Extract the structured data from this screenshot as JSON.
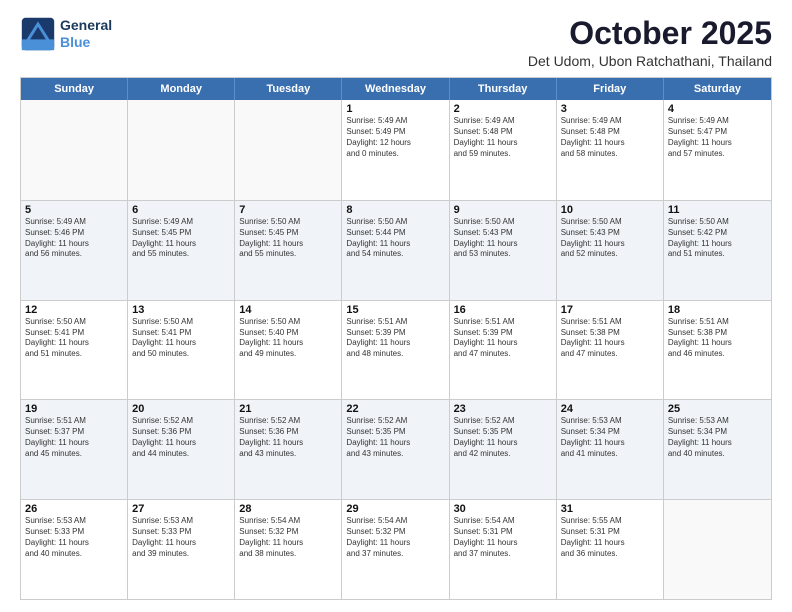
{
  "logo": {
    "line1": "General",
    "line2": "Blue"
  },
  "header": {
    "title": "October 2025",
    "location": "Det Udom, Ubon Ratchathani, Thailand"
  },
  "days_of_week": [
    "Sunday",
    "Monday",
    "Tuesday",
    "Wednesday",
    "Thursday",
    "Friday",
    "Saturday"
  ],
  "weeks": [
    [
      {
        "day": "",
        "empty": true
      },
      {
        "day": "",
        "empty": true
      },
      {
        "day": "",
        "empty": true
      },
      {
        "day": "1",
        "lines": [
          "Sunrise: 5:49 AM",
          "Sunset: 5:49 PM",
          "Daylight: 12 hours",
          "and 0 minutes."
        ]
      },
      {
        "day": "2",
        "lines": [
          "Sunrise: 5:49 AM",
          "Sunset: 5:48 PM",
          "Daylight: 11 hours",
          "and 59 minutes."
        ]
      },
      {
        "day": "3",
        "lines": [
          "Sunrise: 5:49 AM",
          "Sunset: 5:48 PM",
          "Daylight: 11 hours",
          "and 58 minutes."
        ]
      },
      {
        "day": "4",
        "lines": [
          "Sunrise: 5:49 AM",
          "Sunset: 5:47 PM",
          "Daylight: 11 hours",
          "and 57 minutes."
        ]
      }
    ],
    [
      {
        "day": "5",
        "lines": [
          "Sunrise: 5:49 AM",
          "Sunset: 5:46 PM",
          "Daylight: 11 hours",
          "and 56 minutes."
        ]
      },
      {
        "day": "6",
        "lines": [
          "Sunrise: 5:49 AM",
          "Sunset: 5:45 PM",
          "Daylight: 11 hours",
          "and 55 minutes."
        ]
      },
      {
        "day": "7",
        "lines": [
          "Sunrise: 5:50 AM",
          "Sunset: 5:45 PM",
          "Daylight: 11 hours",
          "and 55 minutes."
        ]
      },
      {
        "day": "8",
        "lines": [
          "Sunrise: 5:50 AM",
          "Sunset: 5:44 PM",
          "Daylight: 11 hours",
          "and 54 minutes."
        ]
      },
      {
        "day": "9",
        "lines": [
          "Sunrise: 5:50 AM",
          "Sunset: 5:43 PM",
          "Daylight: 11 hours",
          "and 53 minutes."
        ]
      },
      {
        "day": "10",
        "lines": [
          "Sunrise: 5:50 AM",
          "Sunset: 5:43 PM",
          "Daylight: 11 hours",
          "and 52 minutes."
        ]
      },
      {
        "day": "11",
        "lines": [
          "Sunrise: 5:50 AM",
          "Sunset: 5:42 PM",
          "Daylight: 11 hours",
          "and 51 minutes."
        ]
      }
    ],
    [
      {
        "day": "12",
        "lines": [
          "Sunrise: 5:50 AM",
          "Sunset: 5:41 PM",
          "Daylight: 11 hours",
          "and 51 minutes."
        ]
      },
      {
        "day": "13",
        "lines": [
          "Sunrise: 5:50 AM",
          "Sunset: 5:41 PM",
          "Daylight: 11 hours",
          "and 50 minutes."
        ]
      },
      {
        "day": "14",
        "lines": [
          "Sunrise: 5:50 AM",
          "Sunset: 5:40 PM",
          "Daylight: 11 hours",
          "and 49 minutes."
        ]
      },
      {
        "day": "15",
        "lines": [
          "Sunrise: 5:51 AM",
          "Sunset: 5:39 PM",
          "Daylight: 11 hours",
          "and 48 minutes."
        ]
      },
      {
        "day": "16",
        "lines": [
          "Sunrise: 5:51 AM",
          "Sunset: 5:39 PM",
          "Daylight: 11 hours",
          "and 47 minutes."
        ]
      },
      {
        "day": "17",
        "lines": [
          "Sunrise: 5:51 AM",
          "Sunset: 5:38 PM",
          "Daylight: 11 hours",
          "and 47 minutes."
        ]
      },
      {
        "day": "18",
        "lines": [
          "Sunrise: 5:51 AM",
          "Sunset: 5:38 PM",
          "Daylight: 11 hours",
          "and 46 minutes."
        ]
      }
    ],
    [
      {
        "day": "19",
        "lines": [
          "Sunrise: 5:51 AM",
          "Sunset: 5:37 PM",
          "Daylight: 11 hours",
          "and 45 minutes."
        ]
      },
      {
        "day": "20",
        "lines": [
          "Sunrise: 5:52 AM",
          "Sunset: 5:36 PM",
          "Daylight: 11 hours",
          "and 44 minutes."
        ]
      },
      {
        "day": "21",
        "lines": [
          "Sunrise: 5:52 AM",
          "Sunset: 5:36 PM",
          "Daylight: 11 hours",
          "and 43 minutes."
        ]
      },
      {
        "day": "22",
        "lines": [
          "Sunrise: 5:52 AM",
          "Sunset: 5:35 PM",
          "Daylight: 11 hours",
          "and 43 minutes."
        ]
      },
      {
        "day": "23",
        "lines": [
          "Sunrise: 5:52 AM",
          "Sunset: 5:35 PM",
          "Daylight: 11 hours",
          "and 42 minutes."
        ]
      },
      {
        "day": "24",
        "lines": [
          "Sunrise: 5:53 AM",
          "Sunset: 5:34 PM",
          "Daylight: 11 hours",
          "and 41 minutes."
        ]
      },
      {
        "day": "25",
        "lines": [
          "Sunrise: 5:53 AM",
          "Sunset: 5:34 PM",
          "Daylight: 11 hours",
          "and 40 minutes."
        ]
      }
    ],
    [
      {
        "day": "26",
        "lines": [
          "Sunrise: 5:53 AM",
          "Sunset: 5:33 PM",
          "Daylight: 11 hours",
          "and 40 minutes."
        ]
      },
      {
        "day": "27",
        "lines": [
          "Sunrise: 5:53 AM",
          "Sunset: 5:33 PM",
          "Daylight: 11 hours",
          "and 39 minutes."
        ]
      },
      {
        "day": "28",
        "lines": [
          "Sunrise: 5:54 AM",
          "Sunset: 5:32 PM",
          "Daylight: 11 hours",
          "and 38 minutes."
        ]
      },
      {
        "day": "29",
        "lines": [
          "Sunrise: 5:54 AM",
          "Sunset: 5:32 PM",
          "Daylight: 11 hours",
          "and 37 minutes."
        ]
      },
      {
        "day": "30",
        "lines": [
          "Sunrise: 5:54 AM",
          "Sunset: 5:31 PM",
          "Daylight: 11 hours",
          "and 37 minutes."
        ]
      },
      {
        "day": "31",
        "lines": [
          "Sunrise: 5:55 AM",
          "Sunset: 5:31 PM",
          "Daylight: 11 hours",
          "and 36 minutes."
        ]
      },
      {
        "day": "",
        "empty": true
      }
    ]
  ]
}
